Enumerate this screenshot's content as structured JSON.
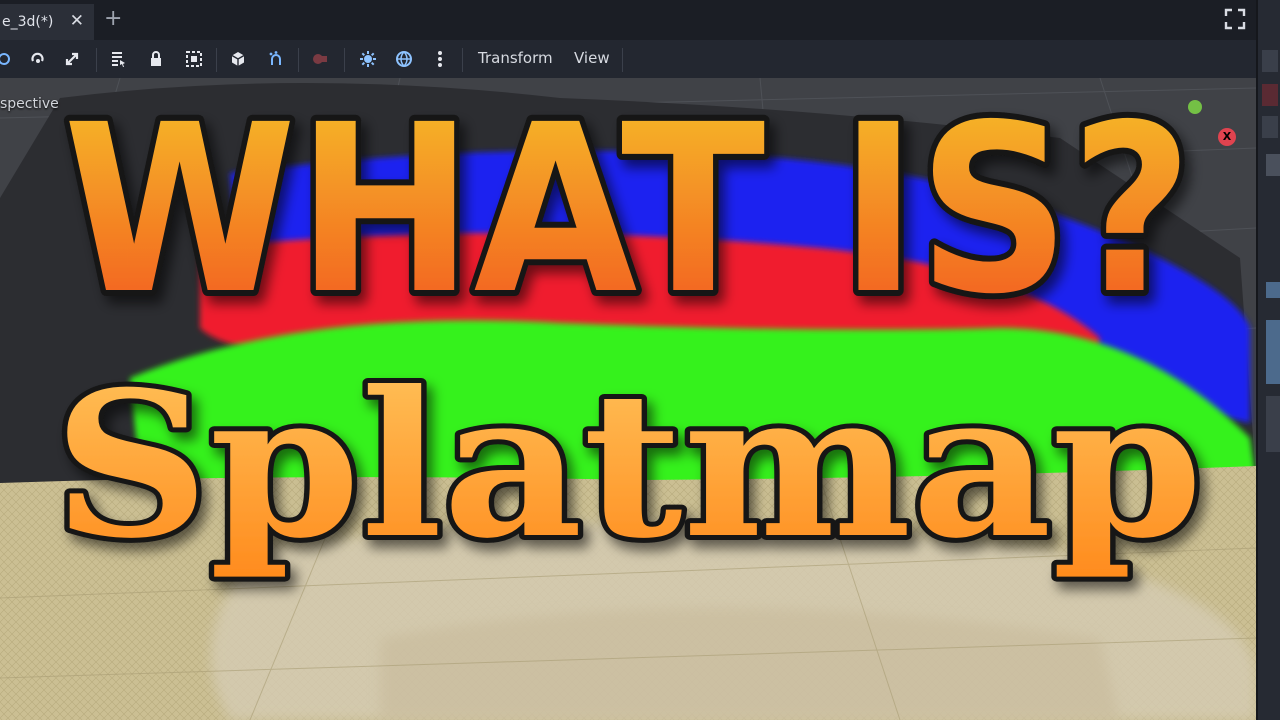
{
  "tabs": {
    "active_label": "e_3d(*)",
    "close_glyph": "✕",
    "add_glyph": "+"
  },
  "toolbar": {
    "icons": [
      "move-icon",
      "rotate-icon",
      "scale-icon",
      "list-select-icon",
      "lock-icon",
      "group-icon",
      "cube-icon",
      "snap-icon",
      "camera-icon",
      "sun-icon",
      "globe-icon",
      "more-icon"
    ],
    "transform_label": "Transform",
    "view_label": "View"
  },
  "viewport": {
    "view_label": "spective",
    "gizmo_x_label": "X"
  },
  "overlay": {
    "headline": "WHAT IS?",
    "subtitle": "Splatmap"
  },
  "colors": {
    "title_top": "#f6c22a",
    "title_bottom": "#f2531f",
    "subtitle_top": "#ffc45c",
    "subtitle_bottom": "#ff8a1c",
    "splat_blue": "#1f23f0",
    "splat_red": "#f01e2e",
    "splat_green": "#36f21f",
    "ground": "#c5b98f"
  }
}
